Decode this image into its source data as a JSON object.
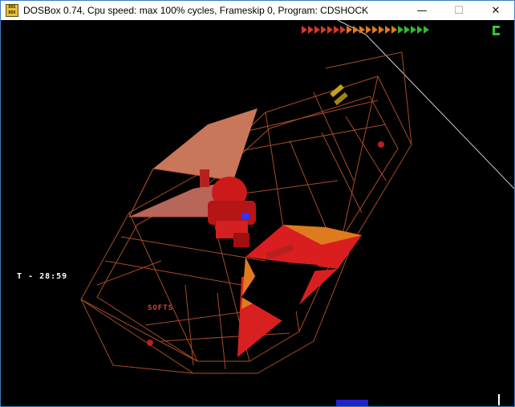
{
  "window": {
    "icon_label": "DOS BOX",
    "title": "DOSBox 0.74, Cpu speed: max 100% cycles, Frameskip  0, Program:  CDSHOCK",
    "minimize_glyph": "—",
    "maximize_glyph": "☐",
    "close_glyph": "✕"
  },
  "hud": {
    "lap_time": "T - 28:59",
    "power_chevrons": [
      "#d23a2a",
      "#d23a2a",
      "#d23a2a",
      "#d23a2a",
      "#d23a2a",
      "#d23a2a",
      "#d23a2a",
      "#e07a1e",
      "#e07a1e",
      "#e07a1e",
      "#e07a1e",
      "#e07a1e",
      "#e07a1e",
      "#e07a1e",
      "#e07a1e",
      "#33b833",
      "#33b833",
      "#33b833",
      "#33b833",
      "#33b833"
    ],
    "gear_color": "#33c433"
  },
  "track": {
    "sign_text": "SOFTS"
  },
  "colors": {
    "wireframe": "#b8552a",
    "car_red": "#cc1a1a",
    "ramp_orange": "#e07a1e"
  }
}
